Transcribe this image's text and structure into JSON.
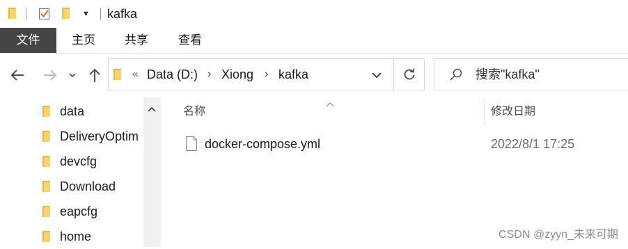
{
  "window": {
    "title": "kafka"
  },
  "ribbon": {
    "tabs": [
      "文件",
      "主页",
      "共享",
      "查看"
    ]
  },
  "address": {
    "overflow_marker": "«",
    "crumbs": [
      "Data (D:)",
      "Xiong",
      "kafka"
    ]
  },
  "search": {
    "placeholder": "搜索\"kafka\""
  },
  "nav_pane": {
    "items": [
      "data",
      "DeliveryOptim",
      "devcfg",
      "Download",
      "eapcfg",
      "home"
    ]
  },
  "content": {
    "columns": {
      "name": "名称",
      "date_modified": "修改日期"
    },
    "files": [
      {
        "name": "docker-compose.yml",
        "date_modified": "2022/8/1 17:25"
      }
    ]
  },
  "watermark": "CSDN @zyyn_未来可期",
  "colors": {
    "folder": "#e8b93f",
    "file_tab": "#454545",
    "accent_check": "#e26a2c"
  },
  "icons": [
    "folder-icon",
    "checkmark-properties-icon",
    "dropdown-icon",
    "back-arrow-icon",
    "forward-arrow-icon",
    "recent-locations-icon",
    "up-arrow-icon",
    "chevron-down-icon",
    "refresh-icon",
    "search-icon",
    "file-icon",
    "scroll-up-icon",
    "sort-up-icon"
  ]
}
